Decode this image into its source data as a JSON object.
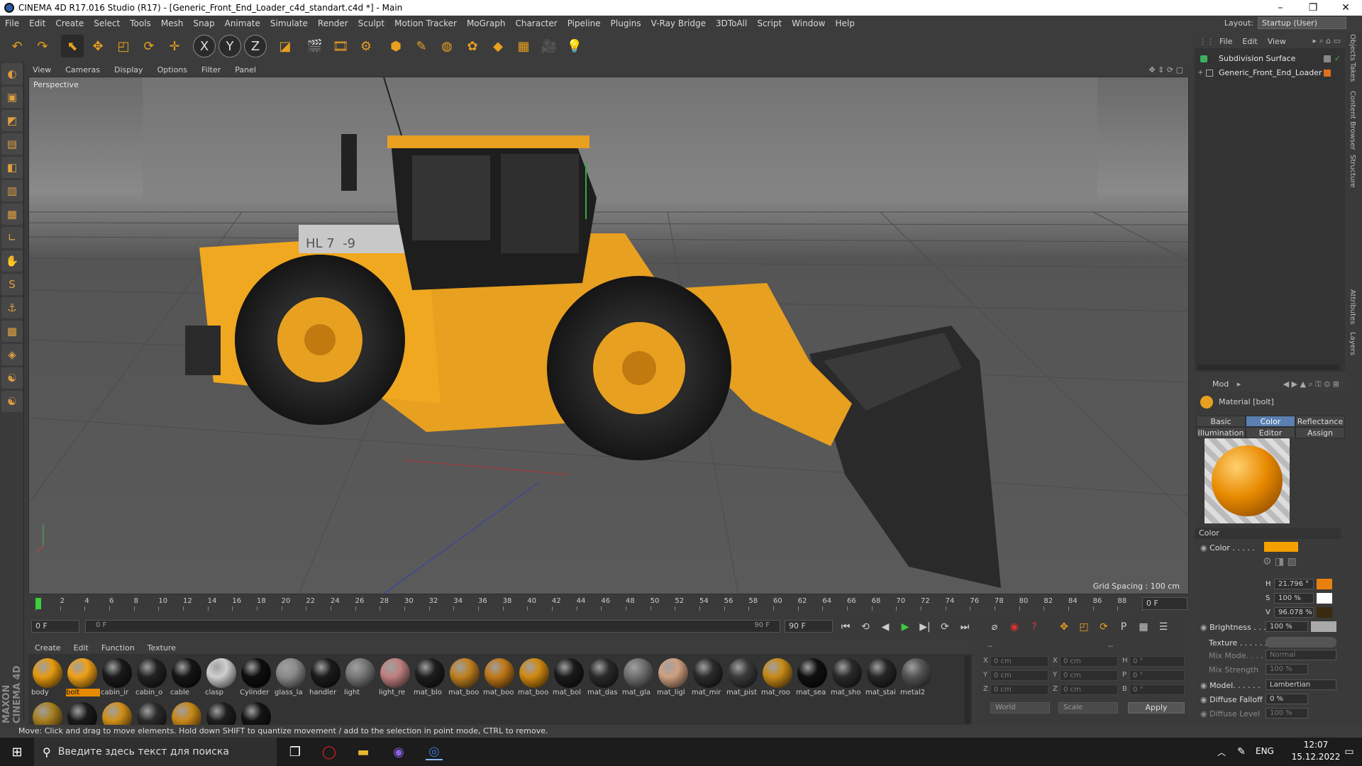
{
  "window": {
    "title": "CINEMA 4D R17.016 Studio (R17) - [Generic_Front_End_Loader_c4d_standart.c4d *] - Main",
    "minimize": "–",
    "restore": "❐",
    "close": "✕"
  },
  "menubar": {
    "items": [
      "File",
      "Edit",
      "Create",
      "Select",
      "Tools",
      "Mesh",
      "Snap",
      "Animate",
      "Simulate",
      "Render",
      "Sculpt",
      "Motion Tracker",
      "MoGraph",
      "Character",
      "Pipeline",
      "Plugins",
      "V-Ray Bridge",
      "3DToAll",
      "Script",
      "Window",
      "Help"
    ],
    "layout_label": "Layout:",
    "layout_value": "Startup (User)"
  },
  "toolbar": {
    "icons": [
      "undo-icon",
      "redo-icon",
      "select-icon",
      "move-icon",
      "scale-icon",
      "rotate-icon",
      "live-select-icon",
      "x-axis-icon",
      "y-axis-icon",
      "z-axis-icon",
      "coordinate-system-icon",
      "render-view-icon",
      "render-picture-viewer-icon",
      "edit-render-settings-icon",
      "cube-icon",
      "pen-spline-icon",
      "subdivision-icon",
      "cloner-icon",
      "deformer-icon",
      "floor-icon",
      "camera-icon",
      "light-icon"
    ],
    "glyphs": [
      "↶",
      "↷",
      "⬉",
      "✥",
      "◰",
      "⟳",
      "✛",
      "X",
      "Y",
      "Z",
      "◪",
      "🎬",
      "🎞",
      "⚙",
      "⬢",
      "✎",
      "◍",
      "✿",
      "◆",
      "▦",
      "🎥",
      "💡"
    ]
  },
  "lefttools": {
    "glyphs": [
      "◐",
      "▣",
      "◩",
      "▤",
      "◧",
      "▥",
      "▦",
      "∟",
      "✋",
      "S",
      "⚓",
      "▩",
      "◈",
      "☯",
      "☯"
    ]
  },
  "viewport": {
    "menu": [
      "View",
      "Cameras",
      "Display",
      "Options",
      "Filter",
      "Panel"
    ],
    "label": "Perspective",
    "grid_spacing": "Grid Spacing : 100 cm",
    "plate_text": "HL 7 -9"
  },
  "timeline": {
    "ticks": [
      "0",
      "2",
      "4",
      "6",
      "8",
      "10",
      "12",
      "14",
      "16",
      "18",
      "20",
      "22",
      "24",
      "26",
      "28",
      "30",
      "32",
      "34",
      "36",
      "38",
      "40",
      "42",
      "44",
      "46",
      "48",
      "50",
      "52",
      "54",
      "56",
      "58",
      "60",
      "62",
      "64",
      "66",
      "68",
      "70",
      "72",
      "74",
      "76",
      "78",
      "80",
      "82",
      "84",
      "86",
      "88",
      "90"
    ],
    "current_frame": "0 F",
    "start_field": "0 F",
    "range_start": "0 F",
    "range_end": "90 F",
    "end_field": "90 F"
  },
  "materials": {
    "menu": [
      "Create",
      "Edit",
      "Function",
      "Texture"
    ],
    "row1": [
      {
        "name": "body",
        "color": "#e69a10"
      },
      {
        "name": "bolt",
        "color": "#f0a018",
        "selected": true
      },
      {
        "name": "cabin_ir",
        "color": "#1a1a1a"
      },
      {
        "name": "cabin_o",
        "color": "#222"
      },
      {
        "name": "cable",
        "color": "#151515"
      },
      {
        "name": "clasp",
        "color": "#d0d0d0"
      },
      {
        "name": "Cylinder",
        "color": "#0e0e0e"
      },
      {
        "name": "glass_la",
        "color": "#8a8a8a"
      },
      {
        "name": "handler",
        "color": "#1b1b1b"
      },
      {
        "name": "light",
        "color": "#777"
      },
      {
        "name": "light_re",
        "color": "#c08080"
      },
      {
        "name": "mat_blo",
        "color": "#1d1d1d"
      },
      {
        "name": "mat_boo",
        "color": "#c08020"
      },
      {
        "name": "mat_boo",
        "color": "#c07818"
      },
      {
        "name": "mat_boo",
        "color": "#d08a10"
      },
      {
        "name": "mat_bol",
        "color": "#1a1a1a"
      },
      {
        "name": "mat_das",
        "color": "#2a2a2a"
      },
      {
        "name": "mat_gla",
        "color": "#707070"
      },
      {
        "name": "mat_ligl",
        "color": "#d0a080"
      },
      {
        "name": "mat_mir",
        "color": "#2b2b2b"
      },
      {
        "name": "mat_pist",
        "color": "#3a3a3a"
      },
      {
        "name": "mat_roo",
        "color": "#c88a18"
      },
      {
        "name": "mat_sea",
        "color": "#101010"
      },
      {
        "name": "mat_sho",
        "color": "#2a2a2a"
      },
      {
        "name": "mat_stai",
        "color": "#262626"
      },
      {
        "name": "metal2",
        "color": "#555"
      }
    ],
    "row2": [
      "#a88020",
      "#1a1a1a",
      "#d09018",
      "#2a2a2a",
      "#c88818",
      "#1e1e1e",
      "#141414"
    ]
  },
  "coords": {
    "col1": [
      "X",
      "Y",
      "Z"
    ],
    "col2": [
      "X",
      "Y",
      "Z"
    ],
    "col3": [
      "H",
      "P",
      "B"
    ],
    "pos": [
      "0 cm",
      "0 cm",
      "0 cm"
    ],
    "size": [
      "0 cm",
      "0 cm",
      "0 cm"
    ],
    "rot": [
      "0 °",
      "0 °",
      "0 °"
    ],
    "header": "--",
    "mode_world": "World",
    "mode_scale": "Scale",
    "apply": "Apply"
  },
  "objects": {
    "menu": [
      "File",
      "Edit",
      "View"
    ],
    "items": [
      {
        "name": "Subdivision Surface",
        "icon": "subdivision-surface-icon"
      },
      {
        "name": "Generic_Front_End_Loader",
        "icon": "null-object-icon"
      }
    ]
  },
  "attributes": {
    "mode": "Mod",
    "material_title": "Material [bolt]",
    "tabs_row1": [
      "Basic",
      "Color",
      "Reflectance"
    ],
    "tabs_row2": [
      "Illumination",
      "Editor",
      "Assign"
    ],
    "active_tab": "Color",
    "section": "Color",
    "color_label": "Color . . . . .",
    "color_swatch": "#f5a000",
    "h_label": "H",
    "h_value": "21.796 °",
    "s_label": "S",
    "s_value": "100 %",
    "v_label": "V",
    "v_value": "96.078 %",
    "brightness_label": "Brightness . . .",
    "brightness_value": "100 %",
    "texture_label": "Texture . . . . . . .",
    "mixmode_label": "Mix Mode. . . . .",
    "mixmode_value": "Normal",
    "mixstrength_label": "Mix Strength",
    "mixstrength_value": "100 %",
    "model_label": "Model. . . . . .",
    "model_value": "Lambertian",
    "diffuse_falloff_label": "Diffuse Falloff",
    "diffuse_falloff_value": "0 %",
    "diffuse_level_label": "Diffuse Level",
    "diffuse_level_value": "100 %"
  },
  "sidetabs": [
    "Objects",
    "Takes",
    "Content Browser",
    "Structure",
    "Attributes",
    "Layers"
  ],
  "status": "Move: Click and drag to move elements. Hold down SHIFT to quantize movement / add to the selection in point mode, CTRL to remove.",
  "taskbar": {
    "search_placeholder": "Введите здесь текст для поиска",
    "lang": "ENG",
    "time": "12:07",
    "date": "15.12.2022"
  },
  "maxon": "MAXON CINEMA 4D"
}
